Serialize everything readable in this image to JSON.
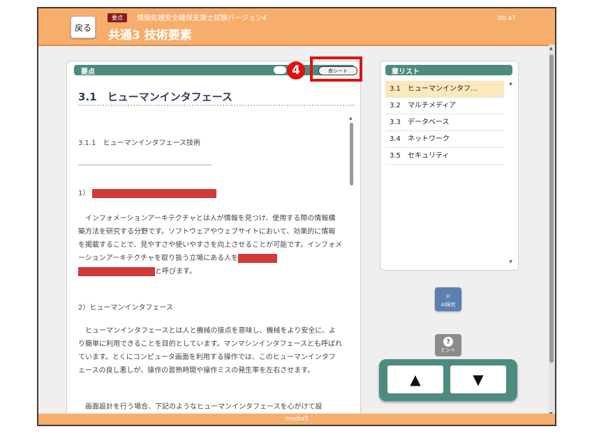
{
  "header": {
    "back_label": "戻る",
    "tag": "要点",
    "exam_title": "情報処理安全確保支援士試験バージョン4",
    "page_title": "共通3 技術要素",
    "time": "00:47"
  },
  "main_panel": {
    "header_label": "要点",
    "red_sheet_label": "赤シート",
    "annotation_number": "4",
    "section_title": "3.1　ヒューマンインタフェース",
    "subsection": "3.1.1　ヒューマンインタフェース技術",
    "item1_label": "1）",
    "para1": "インフォメーションアーキテクチャとは人が情報を見つけ、使用する際の情報構築方法を研究する分野です。ソフトウェアやウェブサイトにおいて、効果的に情報を掲載することで、見やすさや使いやすさを向上させることが可能です。インフォメーションアーキテクチャを取り扱う立場にある人を",
    "para1_end": "と呼びます。",
    "item2_label": "2）ヒューマンインタフェース",
    "para2": "ヒューマンインタフェースとは人と機械の接点を意味し、機械をより安全に、より簡単に利用できることを目的としています。マンマシンインタフェースとも呼ばれています。とくにコンピュータ画面を利用する操作では、このヒューマンインタフェースの良し悪しが、操作の習熟時間や操作ミスの発生率を左右させます。",
    "para3": "画面設計を行う場合、下記のようなヒューマンインタフェースを心がけて設"
  },
  "chapter_list": {
    "header_label": "章リスト",
    "items": [
      {
        "num": "3.1",
        "title": "ヒューマンインタフ…"
      },
      {
        "num": "3.2",
        "title": "マルチメディア"
      },
      {
        "num": "3.3",
        "title": "データベース"
      },
      {
        "num": "3.4",
        "title": "ネットワーク"
      },
      {
        "num": "3.5",
        "title": "セキュリティ"
      }
    ]
  },
  "buttons": {
    "ai_label": "AI探究",
    "hint_label": "ヒント",
    "hint_symbol": "?",
    "up_arrow": "▲",
    "down_arrow": "▼"
  },
  "footer": {
    "label": "media5"
  },
  "colors": {
    "header_orange": "#f7ad6c",
    "teal": "#4d8b80",
    "red_mask": "#d23a3a",
    "highlight_red": "#e21010"
  }
}
